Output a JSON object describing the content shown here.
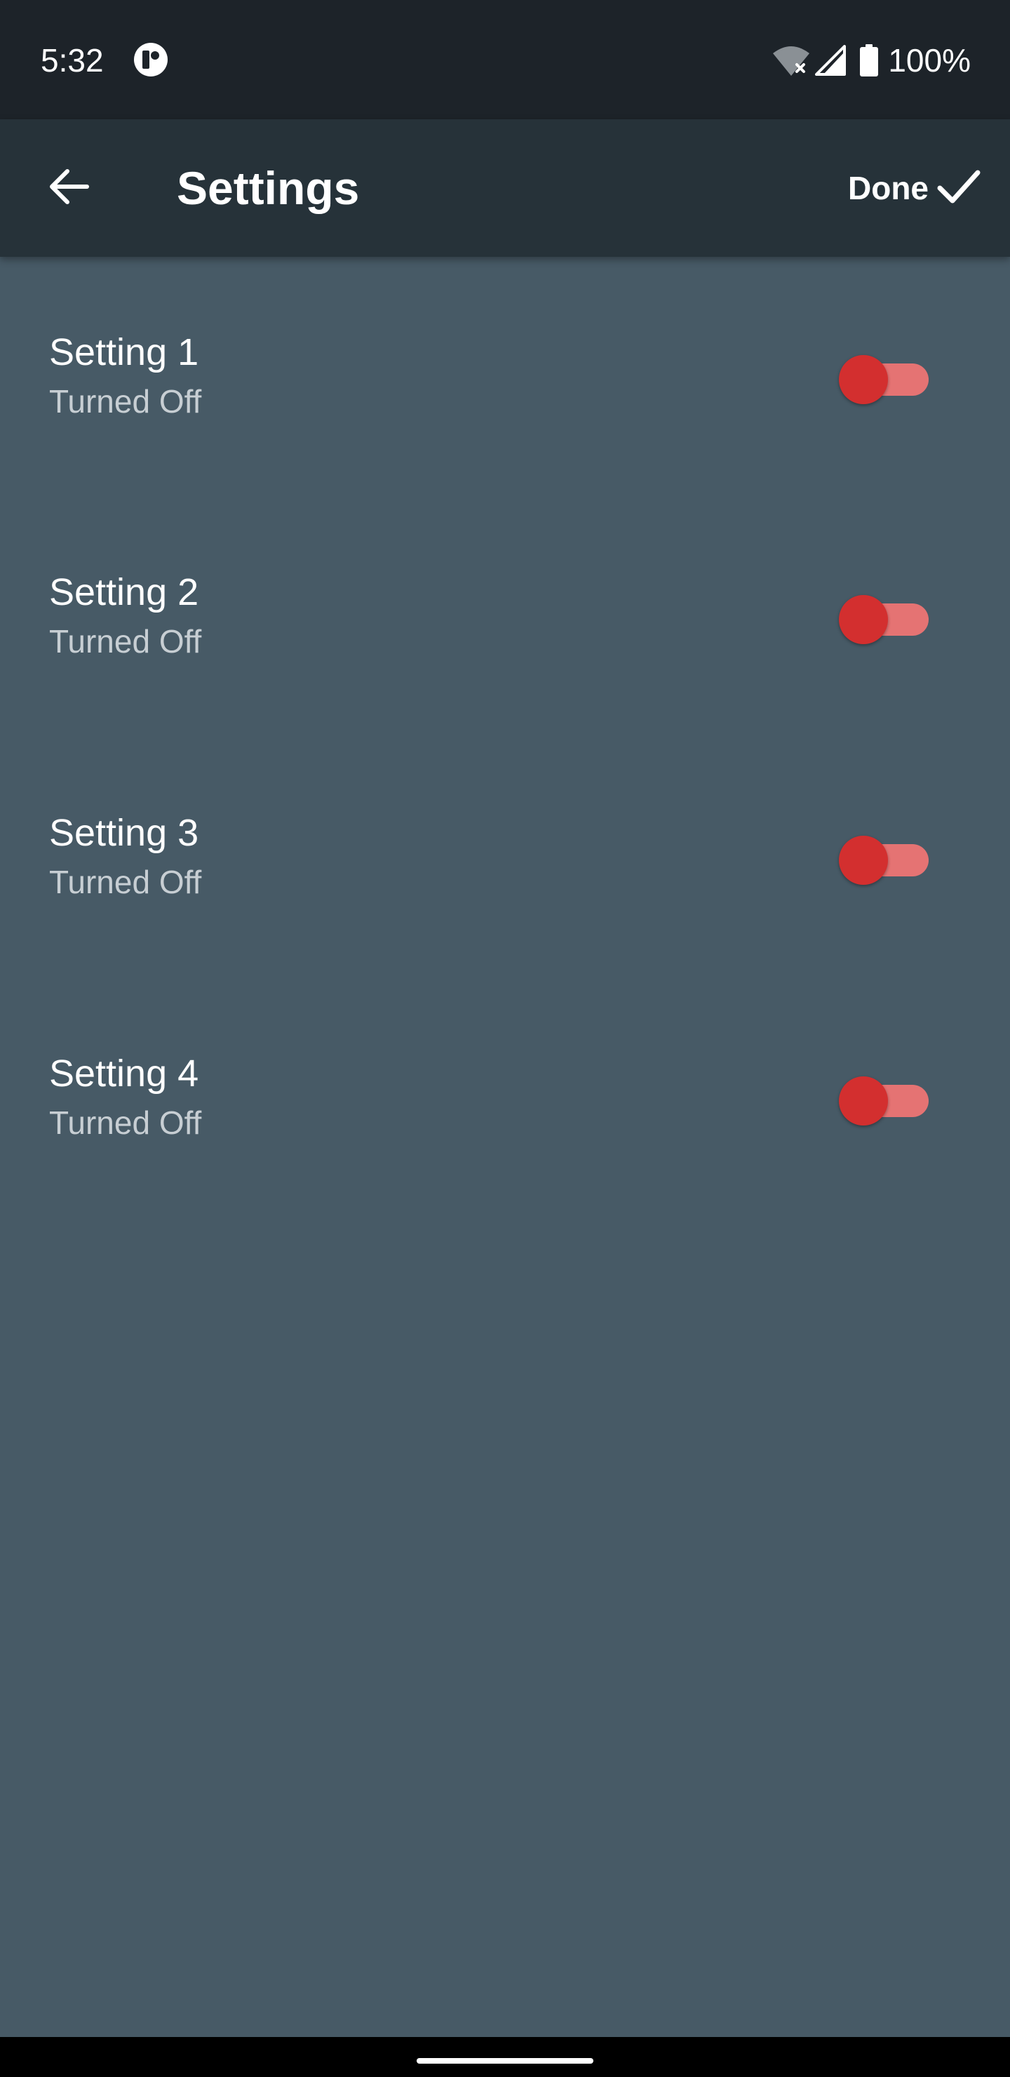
{
  "status_bar": {
    "time": "5:32",
    "battery_percent": "100%",
    "icons": [
      "app-notification-icon",
      "wifi-off-icon",
      "cellular-signal-icon",
      "battery-full-icon"
    ]
  },
  "app_bar": {
    "title": "Settings",
    "done_label": "Done",
    "icons": [
      "arrow-back-icon",
      "check-icon"
    ]
  },
  "settings": [
    {
      "title": "Setting 1",
      "subtitle": "Turned Off",
      "enabled": false
    },
    {
      "title": "Setting 2",
      "subtitle": "Turned Off",
      "enabled": false
    },
    {
      "title": "Setting 3",
      "subtitle": "Turned Off",
      "enabled": false
    },
    {
      "title": "Setting 4",
      "subtitle": "Turned Off",
      "enabled": false
    }
  ],
  "colors": {
    "background": "#475a66",
    "app_bar": "#263239",
    "status_bar": "#1d2329",
    "switch_thumb": "#d32f2f",
    "switch_track": "#e57373"
  }
}
